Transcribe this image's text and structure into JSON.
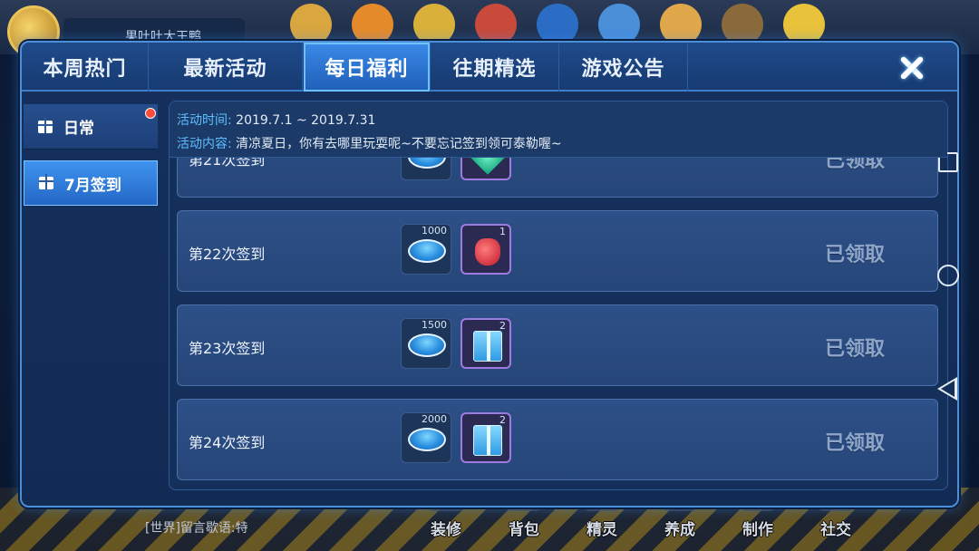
{
  "background": {
    "player_name": "果吐吐大王鸭",
    "chat_hint": "[世界]留言歇语:特",
    "bottom_buttons": [
      "装修",
      "背包",
      "精灵",
      "养成",
      "制作",
      "社交"
    ]
  },
  "tabs": [
    "本周热门",
    "最新活动",
    "每日福利",
    "往期精选",
    "游戏公告"
  ],
  "active_tab": "每日福利",
  "sidebar": {
    "items": [
      {
        "label": "日常",
        "has_dot": true
      },
      {
        "label": "7月签到",
        "active": true
      }
    ]
  },
  "info": {
    "time_label": "活动时间:",
    "time_value": "2019.7.1 ~ 2019.7.31",
    "content_label": "活动内容:",
    "content_value": "清凉夏日，你有去哪里玩耍呢~不要忘记签到领可泰勒喔~"
  },
  "rows": [
    {
      "label": "第21次签到",
      "status": "已领取",
      "coin_amount": "",
      "item_amount": "",
      "item_icon": "gem"
    },
    {
      "label": "第22次签到",
      "status": "已领取",
      "coin_amount": "1000",
      "item_amount": "1",
      "item_icon": "potion"
    },
    {
      "label": "第23次签到",
      "status": "已领取",
      "coin_amount": "1500",
      "item_amount": "2",
      "item_icon": "gift-box"
    },
    {
      "label": "第24次签到",
      "status": "已领取",
      "coin_amount": "2000",
      "item_amount": "2",
      "item_icon": "gift-box"
    }
  ],
  "colors": {
    "accent": "#3a8ae8",
    "label_blue": "#5ec0ff",
    "claimed_text": "#8fa6c9",
    "notify_dot": "#ff4b3a"
  }
}
